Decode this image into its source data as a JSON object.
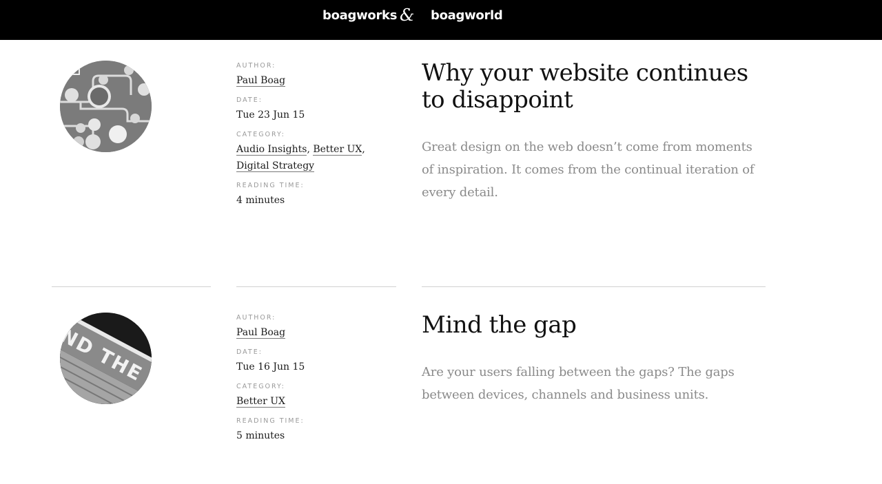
{
  "header": {
    "brand_left": "boagworks",
    "ampersand": "&",
    "brand_right": "boagworld"
  },
  "labels": {
    "author": "AUTHOR:",
    "date": "DATE:",
    "category": "CATEGORY:",
    "reading_time": "READING TIME:"
  },
  "posts": [
    {
      "author": "Paul Boag",
      "date": "Tue 23 Jun 15",
      "categories": [
        "Audio Insights",
        "Better UX",
        "Digital Strategy"
      ],
      "reading_time": "4 minutes",
      "title": "Why your website continues to disappoint",
      "excerpt": "Great design on the web doesn’t come from moments of inspiration. It comes from the continual iteration of every detail."
    },
    {
      "author": "Paul Boag",
      "date": "Tue 16 Jun 15",
      "categories": [
        "Better UX"
      ],
      "reading_time": "5 minutes",
      "title": "Mind the gap",
      "excerpt": "Are your users falling between the gaps? The gaps between devices, channels and business units.",
      "image_text": "ND THE GA"
    }
  ]
}
